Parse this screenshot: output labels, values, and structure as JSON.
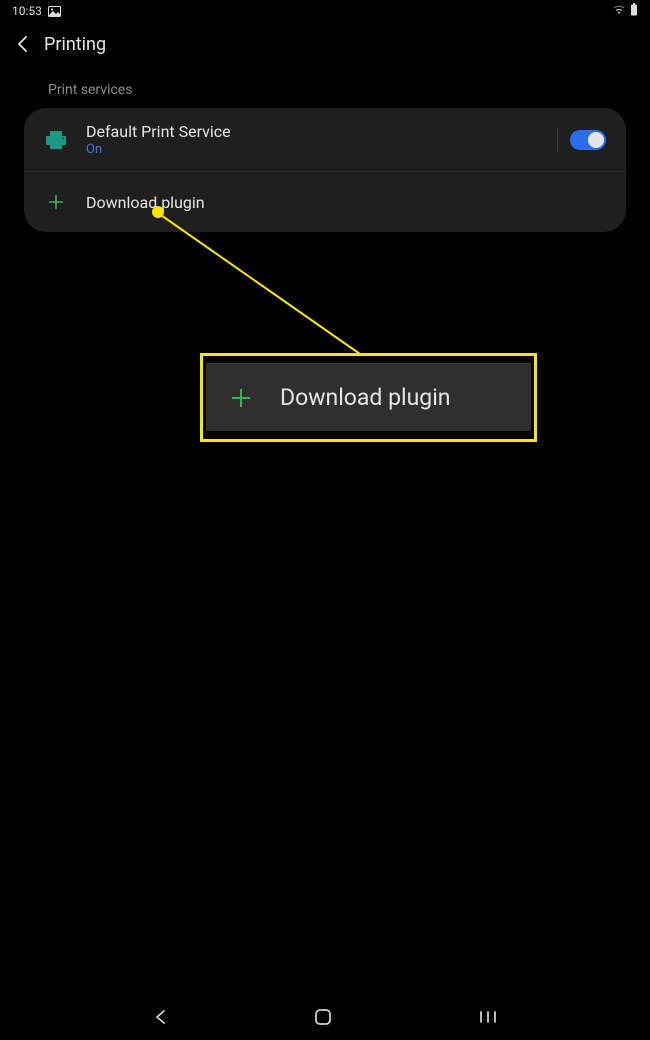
{
  "status_bar": {
    "time": "10:53"
  },
  "header": {
    "title": "Printing"
  },
  "section_label": "Print services",
  "services": {
    "default": {
      "title": "Default Print Service",
      "status": "On",
      "toggle_on": true
    },
    "download": {
      "label": "Download plugin"
    }
  },
  "callout": {
    "label": "Download plugin"
  }
}
